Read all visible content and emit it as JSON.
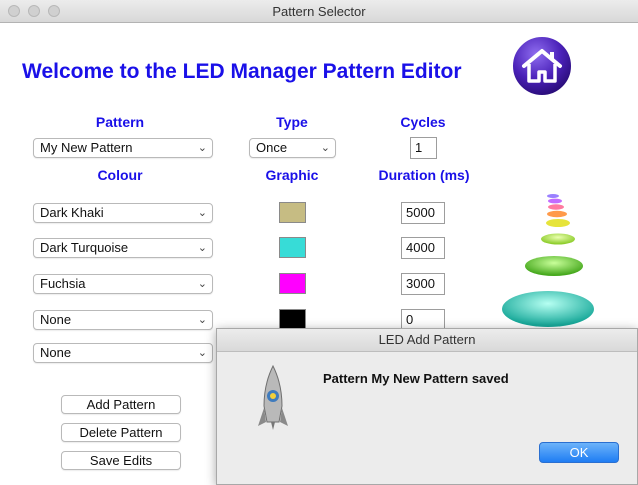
{
  "window": {
    "title": "Pattern Selector"
  },
  "heading": "Welcome to the LED Manager Pattern Editor",
  "columns": {
    "pattern": "Pattern",
    "type": "Type",
    "cycles": "Cycles",
    "colour": "Colour",
    "graphic": "Graphic",
    "duration": "Duration (ms)"
  },
  "pattern_select": {
    "value": "My New Pattern"
  },
  "type_select": {
    "value": "Once"
  },
  "cycles": {
    "value": "1"
  },
  "rows": [
    {
      "colour": "Dark Khaki",
      "swatch": "#c6bc83",
      "duration": "5000"
    },
    {
      "colour": "Dark Turquoise",
      "swatch": "#37dcd7",
      "duration": "4000"
    },
    {
      "colour": "Fuchsia",
      "swatch": "#ff00ff",
      "duration": "3000"
    },
    {
      "colour": "None",
      "swatch": "#000000",
      "duration": "0"
    },
    {
      "colour": "None"
    }
  ],
  "buttons": {
    "add": "Add Pattern",
    "delete": "Delete Pattern",
    "save": "Save Edits"
  },
  "dialog": {
    "title": "LED Add Pattern",
    "message": "Pattern My New Pattern saved",
    "ok": "OK"
  },
  "icons": {
    "home": "home-icon",
    "led_stack": "led-discs-graphic",
    "app": "rocket-app-icon"
  }
}
